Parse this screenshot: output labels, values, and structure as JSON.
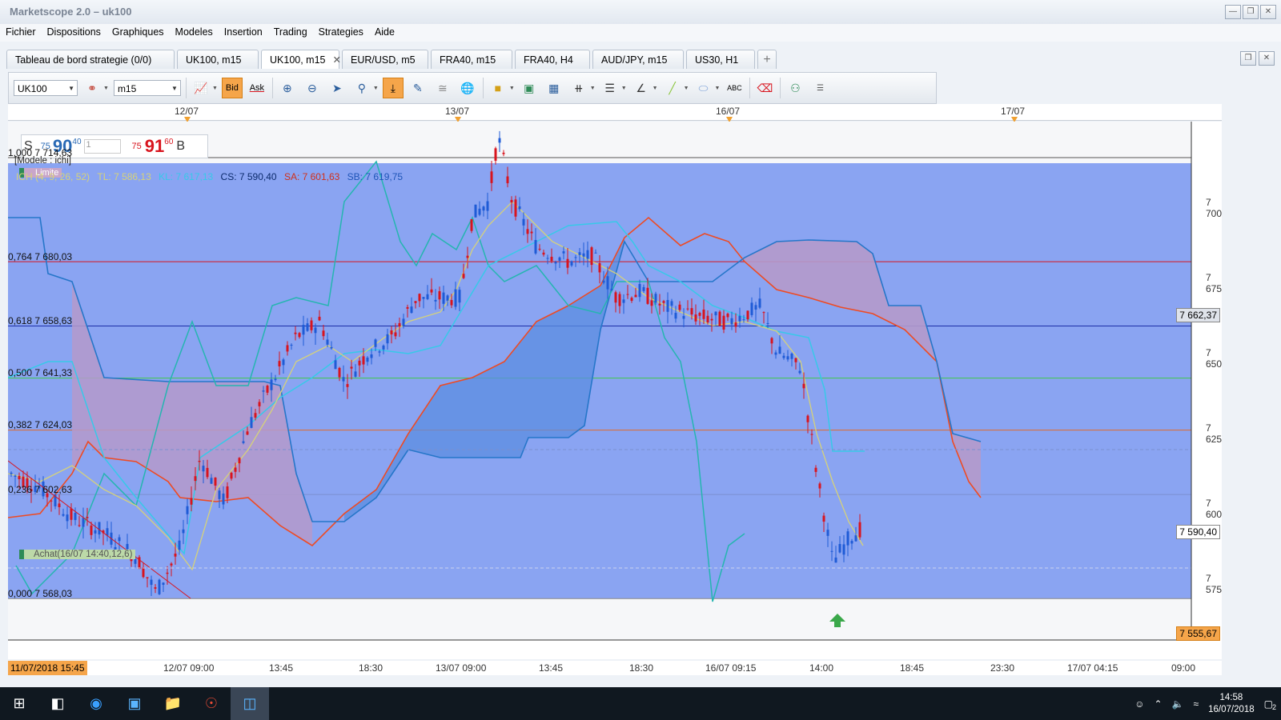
{
  "app": {
    "title": "Marketscope 2.0 – uk100"
  },
  "menu": [
    "Fichier",
    "Dispositions",
    "Graphiques",
    "Modeles",
    "Insertion",
    "Trading",
    "Strategies",
    "Aide"
  ],
  "tabs": [
    {
      "label": "Tableau de bord strategie (0/0)",
      "active": false
    },
    {
      "label": "UK100, m15",
      "active": false
    },
    {
      "label": "UK100, m15",
      "active": true
    },
    {
      "label": "EUR/USD, m5",
      "active": false
    },
    {
      "label": "FRA40, m15",
      "active": false
    },
    {
      "label": "FRA40, H4",
      "active": false
    },
    {
      "label": "AUD/JPY, m15",
      "active": false
    },
    {
      "label": "US30, H1",
      "active": false
    }
  ],
  "toolbar": {
    "instrument": "UK100",
    "timeframe": "m15",
    "bid_label": "Bid",
    "ask_label": "Ask"
  },
  "date_axis": [
    "12/07",
    "13/07",
    "16/07",
    "17/07"
  ],
  "quote": {
    "sell_letter": "S",
    "sell_small": "75",
    "sell_big": "90",
    "sell_sup": "40",
    "amount": "1",
    "buy_small": "75",
    "buy_big": "91",
    "buy_sup": "60",
    "buy_letter": "B"
  },
  "model_label": "[Modele : ichi]",
  "limite_label": "Limite",
  "ichimoku": {
    "title": "ICH (4, 9, 26, 52)",
    "tl": "TL: 7 586,13",
    "kl": "KL: 7 617,13",
    "cs": "CS: 7 590,40",
    "sa": "SA: 7 601,63",
    "sb": "SB: 7 619,75"
  },
  "fib_levels": [
    {
      "label": "1,000 7 714,63",
      "price": 7714.63
    },
    {
      "label": "0,764 7 680,03",
      "price": 7680.03
    },
    {
      "label": "0,618 7 658,63",
      "price": 7658.63
    },
    {
      "label": "0,500 7 641,33",
      "price": 7641.33
    },
    {
      "label": "0,382 7 624,03",
      "price": 7624.03
    },
    {
      "label": "0,236 7 602,63",
      "price": 7602.63
    },
    {
      "label": "0,000 7 568,03",
      "price": 7568.03
    }
  ],
  "order_label": "Achat(16/07 14:40,12,6)",
  "price_ticks": [
    "7 700",
    "7 675",
    "7 650",
    "7 625",
    "7 600",
    "7 575"
  ],
  "price_boxes": {
    "current": "7 662,37",
    "last": "7 590,40",
    "bottom": "7 555,67"
  },
  "time_axis": {
    "start": "11/07/2018 15:45",
    "labels": [
      "12/07 09:00",
      "13:45",
      "18:30",
      "13/07 09:00",
      "13:45",
      "18:30",
      "16/07 09:15",
      "14:00",
      "18:45",
      "23:30",
      "17/07 04:15",
      "09:00"
    ]
  },
  "colors": {
    "bull": "#1f5bd6",
    "bear": "#d8141e",
    "cloud_bg": "#8aa4f2",
    "tenkan": "#d6d27a",
    "kijun": "#37c9e8",
    "chikou": "#25b5b0",
    "senkou_a": "#ef4a22",
    "senkou_b": "#2576c9"
  },
  "taskbar": {
    "time": "14:58",
    "date": "16/07/2018",
    "notif": "2"
  }
}
